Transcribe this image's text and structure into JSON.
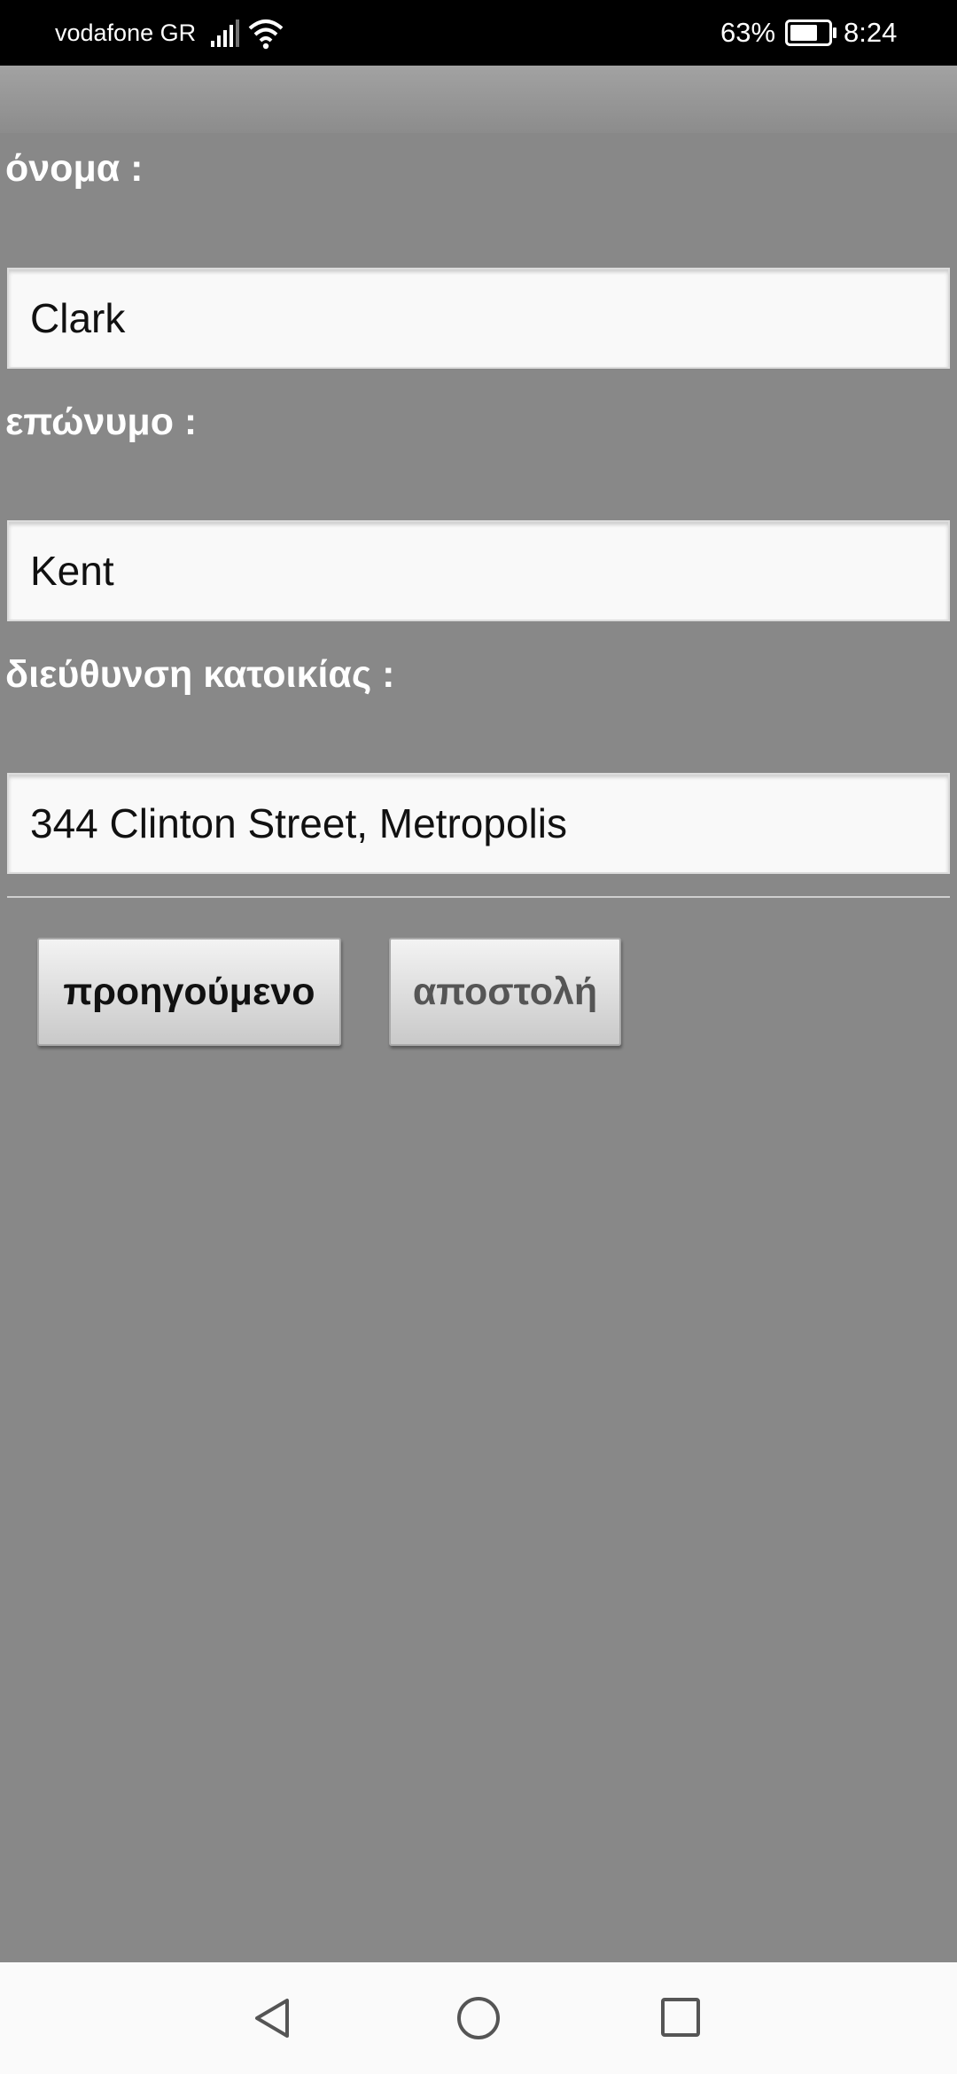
{
  "status_bar": {
    "carrier": "vodafone GR",
    "battery": "63%",
    "time": "8:24",
    "icons": [
      "signal-icon",
      "wifi-icon",
      "battery-icon"
    ]
  },
  "form": {
    "first_name_label": "όνομα :",
    "first_name_value": "Clark",
    "last_name_label": "επώνυμο :",
    "last_name_value": "Kent",
    "address_label": "διεύθυνση κατοικίας :",
    "address_value": "344 Clinton Street, Metropolis"
  },
  "buttons": {
    "previous": "προηγούμενο",
    "send": "αποστολή"
  },
  "nav_bar": {
    "icons": [
      "back-icon",
      "home-icon",
      "recent-apps-icon"
    ]
  },
  "colors": {
    "background": "#888888",
    "status_bar": "#000000",
    "input_background": "#f9f9f9",
    "nav_bar": "#fafafa"
  }
}
